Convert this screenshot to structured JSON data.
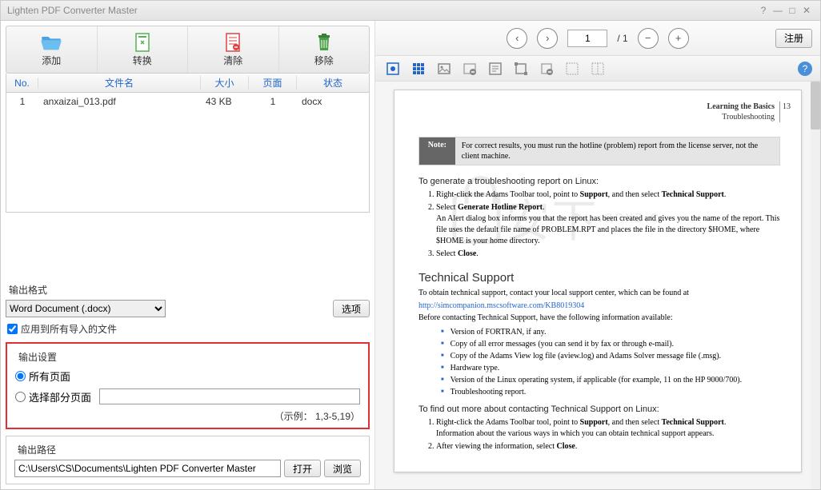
{
  "titlebar": {
    "title": "Lighten PDF Converter Master"
  },
  "toolbar": {
    "add": "添加",
    "convert": "转换",
    "clear": "清除",
    "remove": "移除"
  },
  "table": {
    "headers": {
      "no": "No.",
      "name": "文件名",
      "size": "大小",
      "page": "页面",
      "status": "状态"
    },
    "rows": [
      {
        "no": "1",
        "name": "anxaizai_013.pdf",
        "size": "43 KB",
        "page": "1",
        "status": "docx"
      }
    ]
  },
  "format": {
    "label": "输出格式",
    "selected": "Word Document (.docx)",
    "options_btn": "选项",
    "apply_all": "应用到所有导入的文件"
  },
  "output": {
    "label": "输出设置",
    "all_pages": "所有页面",
    "select_pages": "选择部分页面",
    "example": "（示例： 1,3-5,19）"
  },
  "path": {
    "label": "输出路径",
    "value": "C:\\Users\\CS\\Documents\\Lighten PDF Converter Master",
    "open": "打开",
    "browse": "浏览"
  },
  "preview": {
    "page_input": "1",
    "page_total": "/  1",
    "register": "注册"
  },
  "doc": {
    "header_title": "Learning the Basics",
    "header_sub": "Troubleshooting",
    "header_page": "13",
    "note_label": "Note:",
    "note_text": "For correct results, you must run the hotline (problem) report from the license server, not the client machine.",
    "gen_linux": "To generate a troubleshooting report on Linux:",
    "ol1_1a": "Right-click the Adams Toolbar tool, point to ",
    "ol1_1b": "Support",
    "ol1_1c": ", and then select ",
    "ol1_1d": "Technical Support",
    "ol1_1e": ".",
    "ol1_2a": "Select ",
    "ol1_2b": "Generate Hotline Report",
    "ol1_2c": ".",
    "ol1_2d": "An Alert dialog box informs you that the report has been created and gives you the name of the report. This file uses the default file name of PROBLEM.RPT and places the file in the directory $HOME, where $HOME is your home directory.",
    "ol1_3a": "Select ",
    "ol1_3b": "Close",
    "ol1_3c": ".",
    "tech_h": "Technical Support",
    "tech_p": "To obtain technical support, contact your local support center, which can be found at",
    "tech_link": "http://simcompanion.mscsoftware.com/KB8019304",
    "before": "Before contacting Technical Support, have the following information available:",
    "b1": "Version of FORTRAN, if any.",
    "b2": "Copy of all error messages (you can send it by fax or through e-mail).",
    "b3": "Copy of the Adams View log file (aview.log) and Adams Solver message file (.msg).",
    "b4": "Hardware type.",
    "b5": "Version of the Linux operating system, if applicable (for example, 11 on the HP 9000/700).",
    "b6": "Troubleshooting report.",
    "find_h": "To find out more about contacting Technical Support on Linux:",
    "ol2_1a": "Right-click the Adams Toolbar tool, point to ",
    "ol2_1b": "Support",
    "ol2_1c": ", and then select ",
    "ol2_1d": "Technical Support",
    "ol2_1e": ".",
    "ol2_1f": "Information about the various ways in which you can obtain technical support appears.",
    "ol2_2a": "After viewing the information, select ",
    "ol2_2b": "Close",
    "ol2_2c": "."
  },
  "watermark": {
    "text": "安下",
    "sub": ".anxz.c"
  }
}
